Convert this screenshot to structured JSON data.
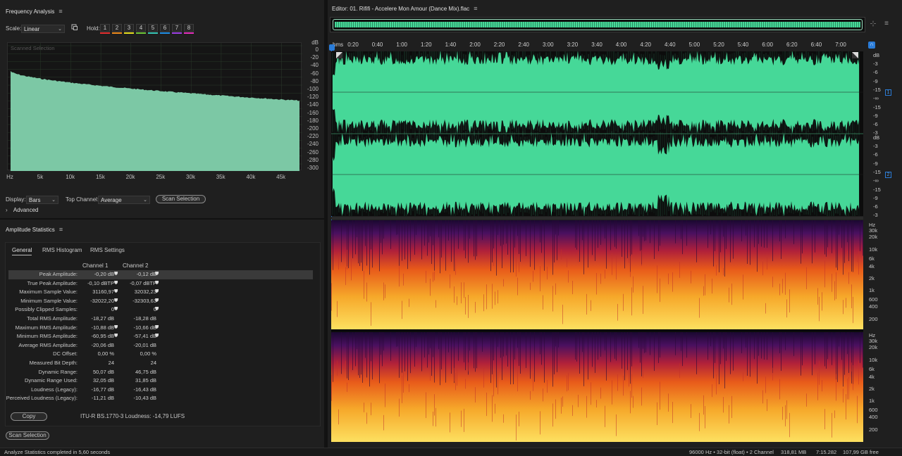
{
  "colors": {
    "wave": "#46d898",
    "freq_fill": "#7cc8a5",
    "hold": [
      "#e83030",
      "#f08c1c",
      "#e8e020",
      "#70c838",
      "#38c8b8",
      "#2090e8",
      "#a040e8",
      "#e830c0"
    ],
    "accent": "#2a7cd8"
  },
  "freq": {
    "title": "Frequency Analysis",
    "scale_label": "Scale:",
    "scale_value": "Linear",
    "hold_label": "Hold:",
    "hold_buttons": [
      "1",
      "2",
      "3",
      "4",
      "5",
      "6",
      "7",
      "8"
    ],
    "scanned_selection": "Scanned Selection",
    "y_unit": "dB",
    "y_ticks": [
      "0",
      "-20",
      "-40",
      "-60",
      "-80",
      "-100",
      "-120",
      "-140",
      "-160",
      "-180",
      "-200",
      "-220",
      "-240",
      "-260",
      "-280",
      "-300"
    ],
    "x_unit": "Hz",
    "x_ticks": [
      "5k",
      "10k",
      "15k",
      "20k",
      "25k",
      "30k",
      "35k",
      "40k",
      "45k"
    ],
    "display_label": "Display:",
    "display_value": "Bars",
    "top_channel_label": "Top Channel:",
    "top_channel_value": "Average",
    "scan_button": "Scan Selection",
    "advanced": "Advanced"
  },
  "amp": {
    "title": "Amplitude Statistics",
    "tabs": [
      "General",
      "RMS Histogram",
      "RMS Settings"
    ],
    "col1": "Channel 1",
    "col2": "Channel 2",
    "rows": [
      {
        "label": "Peak Amplitude:",
        "v1": "-0,20 dB",
        "v2": "-0,12 dB",
        "m1": true,
        "m2": true
      },
      {
        "label": "True Peak Amplitude:",
        "v1": "-0,10 dBTP",
        "v2": "-0,07 dBTP",
        "m1": true,
        "m2": true
      },
      {
        "label": "Maximum Sample Value:",
        "v1": "31160,97",
        "v2": "32032,23",
        "m1": true,
        "m2": true
      },
      {
        "label": "Minimum Sample Value:",
        "v1": "-32022,20",
        "v2": "-32303,63",
        "m1": true,
        "m2": true
      },
      {
        "label": "Possibly Clipped Samples:",
        "v1": "0",
        "v2": "0",
        "m1": true,
        "m2": true
      },
      {
        "label": "Total RMS Amplitude:",
        "v1": "-18,27 dB",
        "v2": "-18,28 dB",
        "m1": false,
        "m2": false
      },
      {
        "label": "Maximum RMS Amplitude:",
        "v1": "-10,88 dB",
        "v2": "-10,66 dB",
        "m1": true,
        "m2": true
      },
      {
        "label": "Minimum RMS Amplitude:",
        "v1": "-60,95 dB",
        "v2": "-57,41 dB",
        "m1": true,
        "m2": true
      },
      {
        "label": "Average RMS Amplitude:",
        "v1": "-20,06 dB",
        "v2": "-20,01 dB",
        "m1": false,
        "m2": false
      },
      {
        "label": "DC Offset:",
        "v1": "0,00 %",
        "v2": "0,00 %",
        "m1": false,
        "m2": false
      },
      {
        "label": "Measured Bit Depth:",
        "v1": "24",
        "v2": "24",
        "m1": false,
        "m2": false
      },
      {
        "label": "Dynamic Range:",
        "v1": "50,07 dB",
        "v2": "46,75 dB",
        "m1": false,
        "m2": false
      },
      {
        "label": "Dynamic Range Used:",
        "v1": "32,05 dB",
        "v2": "31,85 dB",
        "m1": false,
        "m2": false
      },
      {
        "label": "Loudness (Legacy):",
        "v1": "-16,77 dB",
        "v2": "-16,43 dB",
        "m1": false,
        "m2": false
      },
      {
        "label": "Perceived Loudness (Legacy):",
        "v1": "-11,21 dB",
        "v2": "-10,43 dB",
        "m1": false,
        "m2": false
      }
    ],
    "copy_button": "Copy",
    "loudness": "ITU-R BS.1770-3 Loudness: -14,79 LUFS",
    "scan_button": "Scan Selection"
  },
  "editor": {
    "title": "Editor: 01. Rififi - Accelere Mon Amour (Dance Mix).flac",
    "ruler_unit": "hms",
    "ruler": [
      "0:20",
      "0:40",
      "1:00",
      "1:20",
      "1:40",
      "2:00",
      "2:20",
      "2:40",
      "3:00",
      "3:20",
      "3:40",
      "4:00",
      "4:20",
      "4:40",
      "5:00",
      "5:20",
      "5:40",
      "6:00",
      "6:20",
      "6:40",
      "7:00"
    ],
    "db_unit": "dB",
    "db_ticks": [
      "-3",
      "-6",
      "-9",
      "-15",
      "-∞",
      "-15",
      "-9",
      "-6",
      "-3"
    ],
    "hz_unit": "Hz",
    "hz_ticks": [
      "30k",
      "20k",
      "10k",
      "6k",
      "4k",
      "2k",
      "1k",
      "600",
      "400",
      "200"
    ],
    "channel1": "1",
    "channel2": "2"
  },
  "status": {
    "left": "Analyze Statistics completed in 5,60 seconds",
    "format": "96000 Hz • 32-bit (float) • 2 Channel",
    "size": "318,81 MB",
    "duration": "7:15.282",
    "free": "107,99 GB free"
  }
}
